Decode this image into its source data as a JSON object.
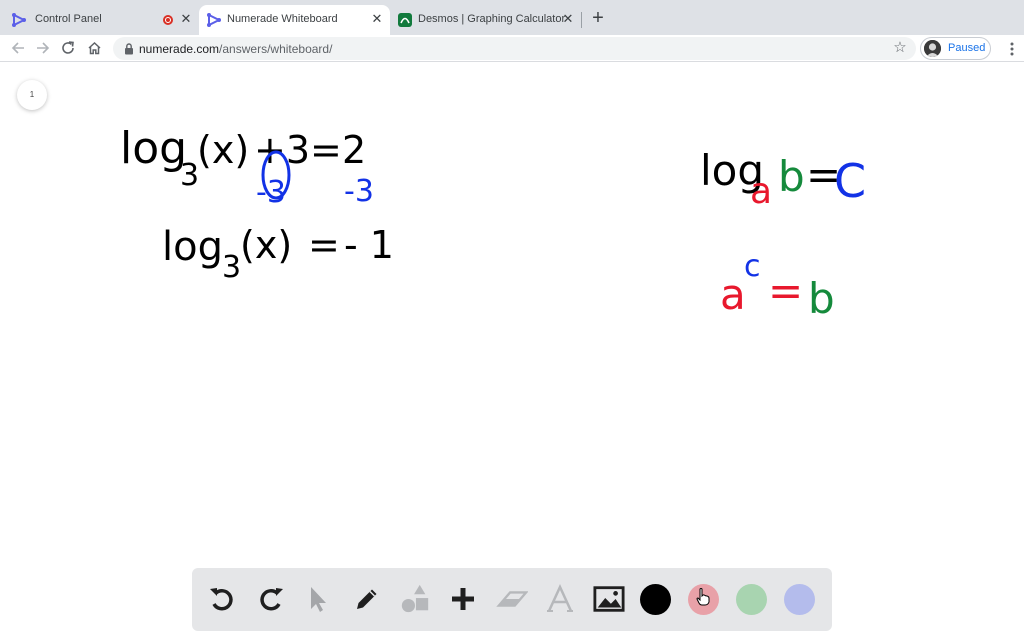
{
  "browser": {
    "tabs": [
      {
        "title": "Control Panel",
        "icon": "numerade-logo-icon",
        "recording": true
      },
      {
        "title": "Numerade Whiteboard",
        "icon": "numerade-logo-icon",
        "active": true
      },
      {
        "title": "Desmos | Graphing Calculator",
        "icon": "desmos-logo-icon"
      }
    ],
    "url_domain": "numerade.com",
    "url_path": "/answers/whiteboard/",
    "profile_status": "Paused"
  },
  "whiteboard": {
    "page_number": "1",
    "left_equation": {
      "line1": {
        "log": "log",
        "base": "3",
        "arg": "(x)",
        "plus": "+3",
        "eq": "=",
        "rhs": "2"
      },
      "line1_correction": {
        "left": "-3",
        "right": "-3"
      },
      "line2": {
        "log": "log",
        "base": "3",
        "arg": "(x)",
        "eq": "=",
        "rhs": "- 1"
      }
    },
    "right_rule": {
      "log": "log",
      "a": "a",
      "b": "b",
      "eq": "=",
      "c": "C",
      "exp_a": "a",
      "exp_c": "c",
      "exp_eq": "=",
      "exp_b": "b"
    },
    "ink_colors": {
      "black": "#000000",
      "red": "#e8182d",
      "green": "#158a3c",
      "blue": "#1232e6"
    }
  },
  "dock": {
    "tools": [
      "undo-icon",
      "redo-icon",
      "select-icon",
      "pen-icon",
      "shapes-icon",
      "add-icon",
      "eraser-icon",
      "text-icon",
      "image-icon"
    ],
    "swatches": [
      {
        "name": "black",
        "color": "#000000"
      },
      {
        "name": "red",
        "color": "#e8a1a8"
      },
      {
        "name": "green",
        "color": "#a8d4b0"
      },
      {
        "name": "blue",
        "color": "#b4bcec"
      }
    ]
  }
}
